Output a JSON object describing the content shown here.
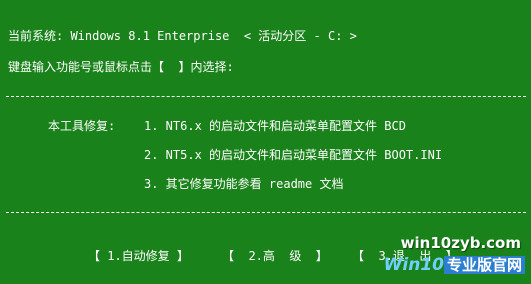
{
  "header": {
    "system_line": "当前系统: Windows 8.1 Enterprise  < 活动分区 - C: >",
    "prompt_line": "键盘输入功能号或鼠标点击【  】内选择:"
  },
  "menu": {
    "label": "本工具修复:",
    "options": [
      {
        "label": "1. NT6.x 的启动文件和启动菜单配置文件 BCD"
      },
      {
        "label": "2. NT5.x 的启动文件和启动菜单配置文件 BOOT.INI"
      },
      {
        "label": "3. 其它修复功能参看 readme 文档"
      }
    ]
  },
  "buttons": {
    "auto": "【 1.自动修复 】",
    "advanced": "【  2.高  级  】",
    "exit": "【  3.退  出  】"
  },
  "watermark": {
    "site": "win10zyb.com",
    "brand_en": "Win10",
    "brand_cn": "专业版官网"
  },
  "colors": {
    "background": "#1a821a",
    "text": "#ffffff"
  }
}
